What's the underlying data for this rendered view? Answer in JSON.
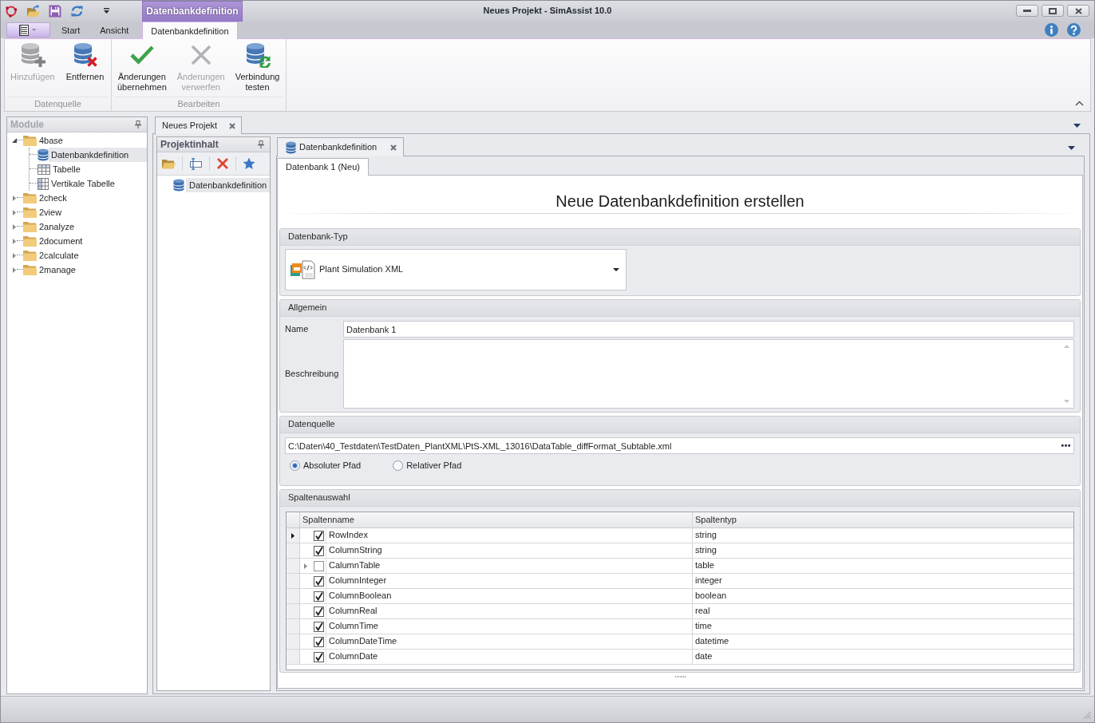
{
  "window": {
    "title": "Neues Projekt - SimAssist 10.0"
  },
  "contextual_tab_group": {
    "label": "Datenbankdefinition"
  },
  "ribbon_tabs": [
    {
      "label": "Start",
      "selected": false
    },
    {
      "label": "Ansicht",
      "selected": false
    },
    {
      "label": "Datenbankdefinition",
      "selected": true
    }
  ],
  "ribbon_groups": [
    {
      "label": "Datenquelle",
      "buttons": [
        {
          "kind": "add",
          "label": "Hinzufügen",
          "disabled": true
        },
        {
          "kind": "remove",
          "label": "Entfernen",
          "disabled": false
        }
      ]
    },
    {
      "label": "Bearbeiten",
      "buttons": [
        {
          "kind": "apply",
          "label": "Änderungen übernehmen",
          "disabled": false
        },
        {
          "kind": "discard",
          "label": "Änderungen verwerfen",
          "disabled": true
        },
        {
          "kind": "test",
          "label": "Verbindung testen",
          "disabled": false
        }
      ]
    }
  ],
  "modules_panel": {
    "title": "Module",
    "tree": [
      {
        "kind": "folder",
        "label": "4base",
        "selected": false,
        "expanded": true,
        "children": [
          {
            "kind": "database",
            "label": "Datenbankdefinition",
            "selected": true
          },
          {
            "kind": "table",
            "label": "Tabelle",
            "selected": false
          },
          {
            "kind": "vertical-table",
            "label": "Vertikale Tabelle",
            "selected": false
          }
        ]
      },
      {
        "kind": "folder",
        "label": "2check",
        "selected": false,
        "expanded": false
      },
      {
        "kind": "folder",
        "label": "2view",
        "selected": false,
        "expanded": false
      },
      {
        "kind": "folder",
        "label": "2analyze",
        "selected": false,
        "expanded": false
      },
      {
        "kind": "folder",
        "label": "2document",
        "selected": false,
        "expanded": false
      },
      {
        "kind": "folder",
        "label": "2calculate",
        "selected": false,
        "expanded": false
      },
      {
        "kind": "folder",
        "label": "2manage",
        "selected": false,
        "expanded": false
      }
    ]
  },
  "document_tabs": [
    {
      "label": "Neues Projekt"
    }
  ],
  "project_panel": {
    "title": "Projektinhalt",
    "items": [
      {
        "kind": "database",
        "label": "Datenbankdefinition",
        "selected": true
      }
    ]
  },
  "editor_tabs": [
    {
      "label": "Datenbankdefinition"
    }
  ],
  "editor_subtabs": [
    {
      "label": "Datenbank 1 (Neu)",
      "selected": true
    }
  ],
  "form": {
    "heading": "Neue Datenbankdefinition erstellen",
    "database_type": {
      "title": "Datenbank-Typ",
      "value": "Plant Simulation XML"
    },
    "general": {
      "title": "Allgemein",
      "fields": [
        {
          "kind": "text",
          "label": "Name",
          "value": "Datenbank 1"
        },
        {
          "kind": "multiline",
          "label": "Beschreibung"
        }
      ]
    },
    "data_source": {
      "title": "Datenquelle",
      "path": "C:\\Daten\\40_Testdaten\\TestDaten_PlantXML\\PtS-XML_13016\\DataTable_diffFormat_Subtable.xml",
      "path_modes": [
        {
          "label": "Absoluter Pfad",
          "selected": true
        },
        {
          "label": "Relativer Pfad",
          "selected": false
        }
      ]
    },
    "column_selection": {
      "title": "Spaltenauswahl",
      "columns": [
        "Spaltenname",
        "Spaltentyp"
      ],
      "rows": [
        {
          "name": "RowIndex",
          "type": "string",
          "checked": true,
          "selected": true
        },
        {
          "name": "ColumnString",
          "type": "string",
          "checked": true,
          "selected": false
        },
        {
          "name": "CalumnTable",
          "type": "table",
          "checked": false,
          "selected": false,
          "expanded": false
        },
        {
          "name": "ColumnInteger",
          "type": "integer",
          "checked": true,
          "selected": false
        },
        {
          "name": "ColumnBoolean",
          "type": "boolean",
          "checked": true,
          "selected": false
        },
        {
          "name": "ColumnReal",
          "type": "real",
          "checked": true,
          "selected": false
        },
        {
          "name": "ColumnTime",
          "type": "time",
          "checked": true,
          "selected": false
        },
        {
          "name": "ColumnDateTime",
          "type": "datetime",
          "checked": true,
          "selected": false
        },
        {
          "name": "ColumnDate",
          "type": "date",
          "checked": true,
          "selected": false
        }
      ]
    }
  }
}
